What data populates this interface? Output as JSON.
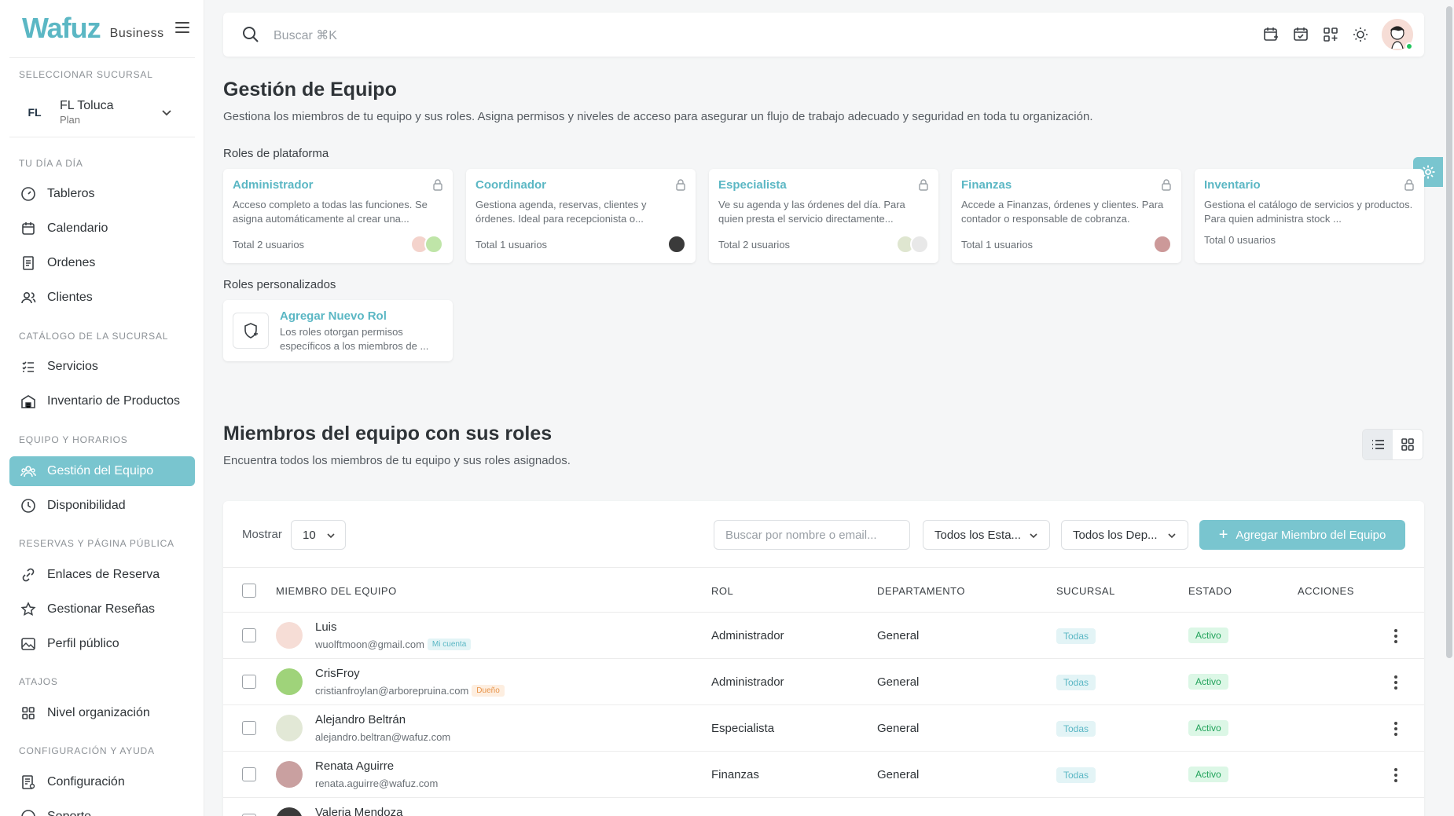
{
  "brand": {
    "logo": "Wafuz",
    "sub": "Business"
  },
  "branch_selector": {
    "section_label": "SELECCIONAR SUCURSAL",
    "logo_text": "FL",
    "name": "FL Toluca",
    "plan": "Plan"
  },
  "sidebar": {
    "sections": [
      {
        "label": "TU DÍA A DÍA",
        "items": [
          {
            "label": "Tableros",
            "icon": "gauge-icon"
          },
          {
            "label": "Calendario",
            "icon": "calendar-icon"
          },
          {
            "label": "Ordenes",
            "icon": "receipt-icon"
          },
          {
            "label": "Clientes",
            "icon": "users-icon"
          }
        ]
      },
      {
        "label": "CATÁLOGO DE LA SUCURSAL",
        "items": [
          {
            "label": "Servicios",
            "icon": "list-check-icon"
          },
          {
            "label": "Inventario de Productos",
            "icon": "building-icon"
          }
        ]
      },
      {
        "label": "EQUIPO Y HORARIOS",
        "items": [
          {
            "label": "Gestión del Equipo",
            "icon": "team-icon",
            "active": true
          },
          {
            "label": "Disponibilidad",
            "icon": "clock-icon"
          }
        ]
      },
      {
        "label": "RESERVAS Y PÁGINA PÚBLICA",
        "items": [
          {
            "label": "Enlaces de Reserva",
            "icon": "link-icon"
          },
          {
            "label": "Gestionar Reseñas",
            "icon": "star-icon"
          },
          {
            "label": "Perfil público",
            "icon": "image-icon"
          }
        ]
      },
      {
        "label": "ATAJOS",
        "items": [
          {
            "label": "Nivel organización",
            "icon": "grid-icon"
          }
        ]
      },
      {
        "label": "CONFIGURACIÓN Y AYUDA",
        "items": [
          {
            "label": "Configuración",
            "icon": "settings-doc-icon"
          },
          {
            "label": "Soporte",
            "icon": "help-icon"
          }
        ]
      }
    ]
  },
  "topbar": {
    "search_placeholder": "Buscar ⌘K"
  },
  "page": {
    "title": "Gestión de Equipo",
    "description": "Gestiona los miembros de tu equipo y sus roles. Asigna permisos y niveles de acceso para asegurar un flujo de trabajo adecuado y seguridad en toda tu organización.",
    "platform_roles_label": "Roles de plataforma",
    "custom_roles_label": "Roles personalizados"
  },
  "roles": [
    {
      "name": "Administrador",
      "desc": "Acceso completo a todas las funciones. Se asigna automáticamente al crear una...",
      "total": "Total 2 usuarios"
    },
    {
      "name": "Coordinador",
      "desc": "Gestiona agenda, reservas, clientes y órdenes. Ideal para recepcionista o...",
      "total": "Total 1 usuarios"
    },
    {
      "name": "Especialista",
      "desc": "Ve su agenda y las órdenes del día. Para quien presta el servicio directamente...",
      "total": "Total 2 usuarios"
    },
    {
      "name": "Finanzas",
      "desc": "Accede a Finanzas, órdenes y clientes. Para contador o responsable de cobranza.",
      "total": "Total 1 usuarios"
    },
    {
      "name": "Inventario",
      "desc": "Gestiona el catálogo de servicios y productos. Para quien administra stock ...",
      "total": "Total 0 usuarios"
    }
  ],
  "new_role": {
    "title": "Agregar Nuevo Rol",
    "desc": "Los roles otorgan permisos específicos a los miembros de ..."
  },
  "members": {
    "title": "Miembros del equipo con sus roles",
    "description": "Encuentra todos los miembros de tu equipo y sus roles asignados.",
    "show_label": "Mostrar",
    "page_size": "10",
    "search_placeholder": "Buscar por nombre o email...",
    "status_filter": "Todos los Esta...",
    "dept_filter": "Todos los Dep...",
    "add_button": "Agregar Miembro del Equipo",
    "columns": [
      "MIEMBRO DEL EQUIPO",
      "ROL",
      "DEPARTAMENTO",
      "SUCURSAL",
      "ESTADO",
      "ACCIONES"
    ],
    "rows": [
      {
        "name": "Luis",
        "email": "wuolftmoon@gmail.com",
        "badge": "Mi cuenta",
        "role": "Administrador",
        "dept": "General",
        "branch": "Todas",
        "status": "Activo"
      },
      {
        "name": "CrisFroy",
        "email": "cristianfroylan@arborepruina.com",
        "badge": "Dueño",
        "role": "Administrador",
        "dept": "General",
        "branch": "Todas",
        "status": "Activo"
      },
      {
        "name": "Alejandro Beltrán",
        "email": "alejandro.beltran@wafuz.com",
        "badge": "",
        "role": "Especialista",
        "dept": "General",
        "branch": "Todas",
        "status": "Activo"
      },
      {
        "name": "Renata Aguirre",
        "email": "renata.aguirre@wafuz.com",
        "badge": "",
        "role": "Finanzas",
        "dept": "General",
        "branch": "Todas",
        "status": "Activo"
      },
      {
        "name": "Valeria Mendoza",
        "email": "",
        "badge": "",
        "role": "",
        "dept": "",
        "branch": "",
        "status": ""
      }
    ]
  },
  "colors": {
    "accent": "#79c5cf",
    "accent_text": "#5bb7c4",
    "active_green": "#22a35b"
  }
}
